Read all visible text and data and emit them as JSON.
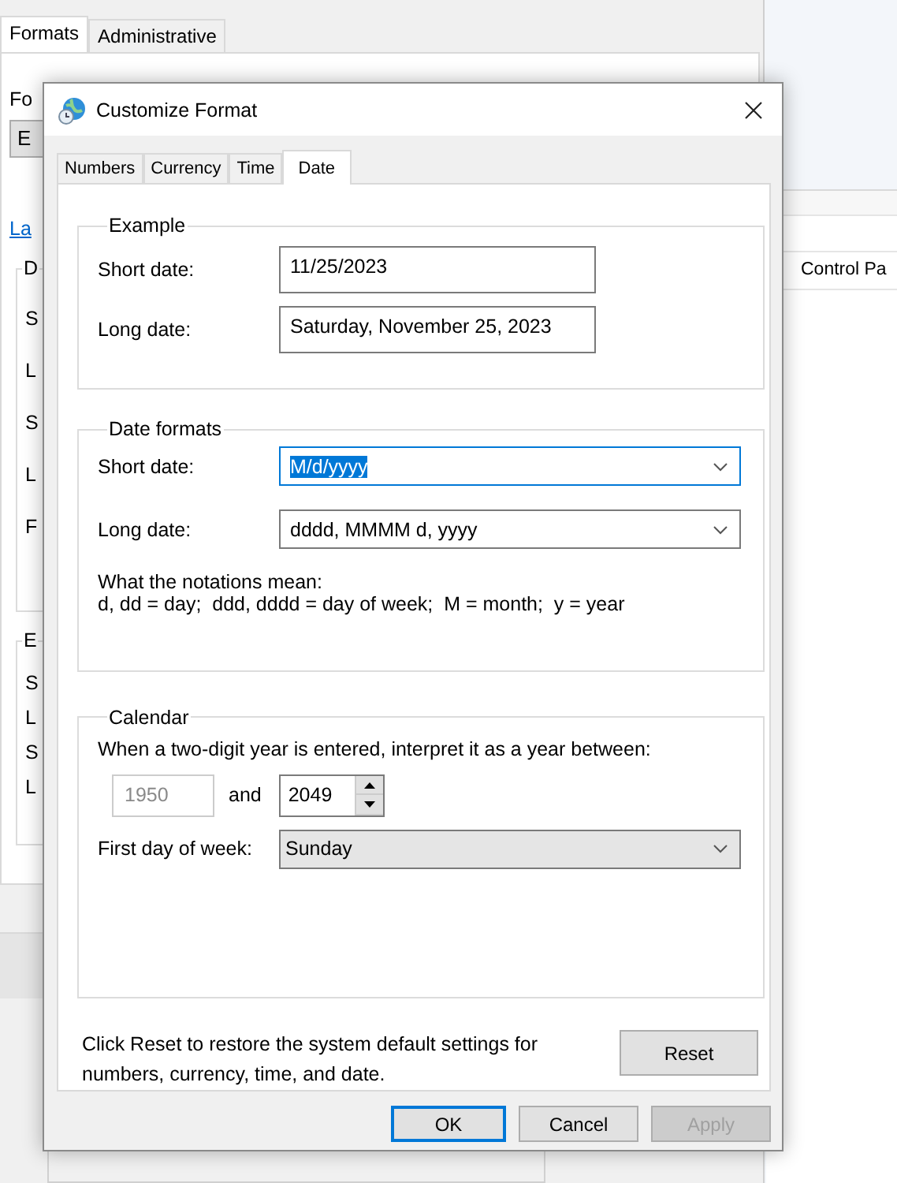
{
  "background_window": {
    "tabs": [
      {
        "label": "Formats",
        "selected": true
      },
      {
        "label": "Administrative",
        "selected": false
      }
    ],
    "format_label": "Fo",
    "format_value": "E",
    "link": "La",
    "groups": [
      {
        "legend": "D",
        "labels": [
          "S",
          "L",
          "S",
          "L",
          "F"
        ]
      },
      {
        "legend": "E",
        "labels": [
          "S",
          "L",
          "S",
          "L"
        ]
      }
    ]
  },
  "side_window": {
    "item": "Control Pa"
  },
  "dialog": {
    "title": "Customize Format",
    "tabs": [
      {
        "label": "Numbers",
        "selected": false
      },
      {
        "label": "Currency",
        "selected": false
      },
      {
        "label": "Time",
        "selected": false
      },
      {
        "label": "Date",
        "selected": true
      }
    ],
    "example": {
      "legend": "Example",
      "rows": [
        {
          "label": "Short date:",
          "value": "11/25/2023"
        },
        {
          "label": "Long date:",
          "value": "Saturday, November 25, 2023"
        }
      ]
    },
    "date_formats": {
      "legend": "Date formats",
      "rows": [
        {
          "label": "Short date:",
          "value": "M/d/yyyy",
          "focused": true
        },
        {
          "label": "Long date:",
          "value": "dddd, MMMM d, yyyy",
          "focused": false
        }
      ],
      "notes_title": "What the notations mean:",
      "notes": "d, dd = day;  ddd, dddd = day of week;  M = month;  y = year"
    },
    "calendar": {
      "legend": "Calendar",
      "prompt": "When a two-digit year is entered, interpret it as a year between:",
      "from_year": "1950",
      "from_disabled": true,
      "and": "and",
      "to_year": "2049",
      "first_day_label": "First day of week:",
      "first_day": "Sunday"
    },
    "reset_text": "Click Reset to restore the system default settings for numbers, currency, time, and date.",
    "reset": "Reset",
    "buttons": [
      {
        "label": "OK",
        "default": true,
        "disabled": false
      },
      {
        "label": "Cancel",
        "default": false,
        "disabled": false
      },
      {
        "label": "Apply",
        "default": false,
        "disabled": true
      }
    ]
  }
}
